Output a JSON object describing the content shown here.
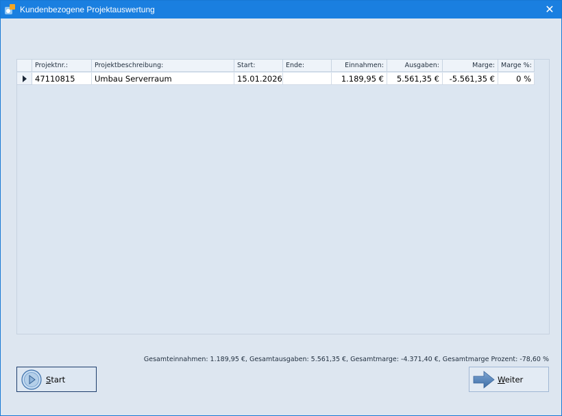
{
  "window": {
    "title": "Kundenbezogene Projektauswertung",
    "close_symbol": "✕"
  },
  "grid": {
    "columns": [
      "Projektnr.:",
      "Projektbeschreibung:",
      "Start:",
      "Ende:",
      "Einnahmen:",
      "Ausgaben:",
      "Marge:",
      "Marge %:"
    ],
    "rows": [
      [
        "47110815",
        "Umbau Serverraum",
        "15.01.2026",
        "",
        "1.189,95 €",
        "5.561,35 €",
        "-5.561,35 €",
        "0 %"
      ]
    ]
  },
  "summary": "Gesamteinnahmen: 1.189,95 €, Gesamtausgaben: 5.561,35 €, Gesamtmarge: -4.371,40 €, Gesamtmarge Prozent: -78,60 %",
  "buttons": {
    "start": {
      "accel": "S",
      "rest": "tart",
      "icon": "play-circle-icon"
    },
    "next": {
      "accel": "W",
      "rest": "eiter",
      "icon": "arrow-right-icon"
    }
  },
  "colors": {
    "titlebar": "#1a7fe0",
    "window_bg": "#dde6f0"
  }
}
